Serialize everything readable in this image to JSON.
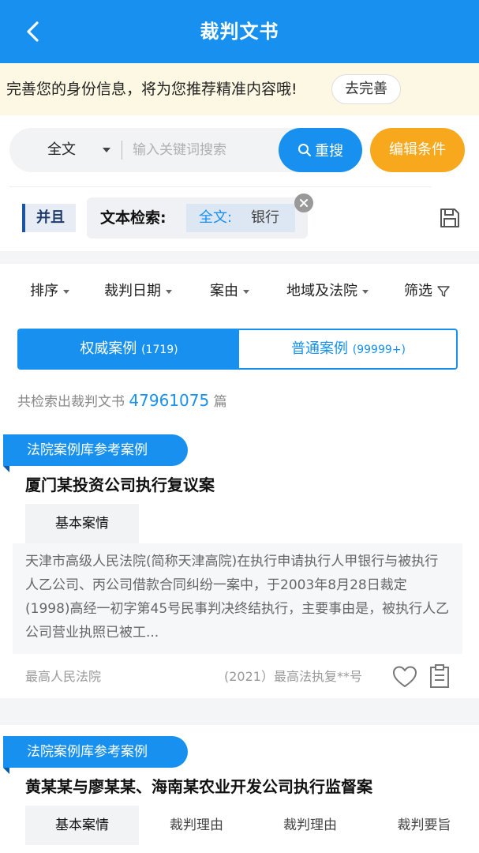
{
  "header": {
    "title": "裁判文书",
    "back_icon": "chevron-left-icon"
  },
  "banner": {
    "message": "完善您的身份信息，将为您推荐精准内容哦!",
    "button_label": "去完善"
  },
  "search": {
    "scope_value": "全文",
    "placeholder": "输入关键词搜索",
    "research_label": "重搜",
    "edit_label": "编辑条件"
  },
  "condition": {
    "logic": "并且",
    "label": "文本检索:",
    "field": "全文:",
    "value": "银行"
  },
  "filters": [
    {
      "label": "排序"
    },
    {
      "label": "裁判日期"
    },
    {
      "label": "案由"
    },
    {
      "label": "地域及法院"
    },
    {
      "label": "筛选"
    }
  ],
  "tabs": [
    {
      "label": "权威案例",
      "count": "(1719)"
    },
    {
      "label": "普通案例",
      "count": "(99999+)"
    }
  ],
  "total": {
    "prefix": "共检索出裁判文书",
    "count": "47961075",
    "suffix": "篇"
  },
  "cards": [
    {
      "ribbon": "法院案例库参考案例",
      "title": "厦门某投资公司执行复议案",
      "sections": [
        "基本案情"
      ],
      "summary": "天津市高级人民法院(简称天津高院)在执行申请执行人甲银行与被执行人乙公司、丙公司借款合同纠纷一案中，于2003年8月28日裁定(1998)高经一初字第45号民事判决终结执行，主要事由是，被执行人乙公司营业执照已被工...",
      "court": "最高人民法院",
      "case_no": "(2021）最高法执复**号"
    },
    {
      "ribbon": "法院案例库参考案例",
      "title": "黄某某与廖某某、海南某农业开发公司执行监督案",
      "sections": [
        "基本案情",
        "裁判理由",
        "裁判理由",
        "裁判要旨"
      ]
    }
  ],
  "colors": {
    "brand": "#1790f0",
    "accent": "#f8a81d",
    "banner_bg": "#fdf8e3"
  }
}
